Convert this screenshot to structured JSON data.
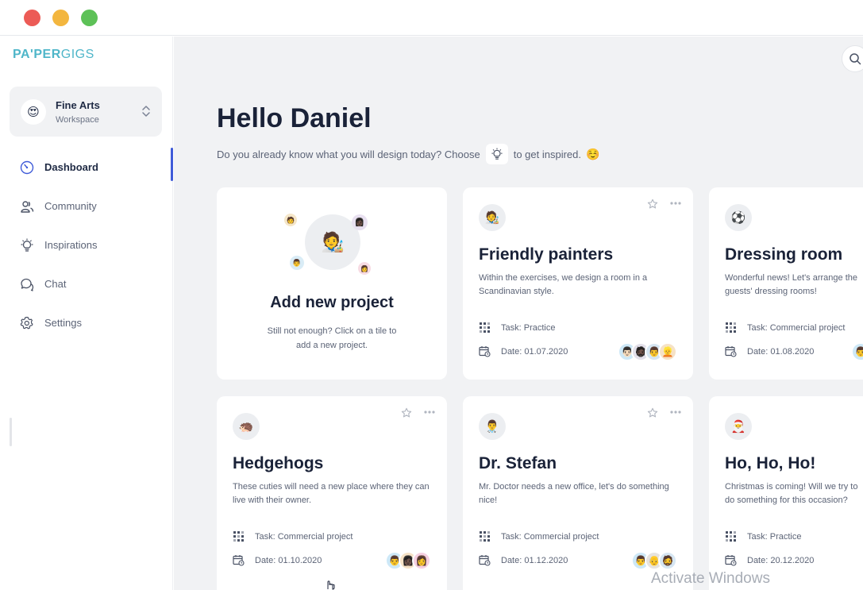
{
  "window": {
    "controls": [
      "close",
      "minimize",
      "maximize"
    ]
  },
  "sidebar": {
    "logo": {
      "bold": "PA'PER",
      "light": "GIGS"
    },
    "workspace": {
      "avatar_emoji": "😍",
      "name": "Fine Arts",
      "subtitle": "Workspace"
    },
    "nav": [
      {
        "label": "Dashboard",
        "icon": "dashboard-gauge-icon",
        "active": true
      },
      {
        "label": "Community",
        "icon": "community-people-icon",
        "active": false
      },
      {
        "label": "Inspirations",
        "icon": "lightbulb-icon",
        "active": false
      },
      {
        "label": "Chat",
        "icon": "chat-bubbles-icon",
        "active": false
      },
      {
        "label": "Settings",
        "icon": "gear-icon",
        "active": false
      }
    ]
  },
  "main": {
    "greeting": "Hello Daniel",
    "subtitle_before": "Do you already know what you will design today? Choose",
    "subtitle_after": "to get inspired.",
    "subtitle_emoji": "☺️",
    "add_card": {
      "title": "Add new project",
      "description": "Still not enough? Click on a tile to add a new project.",
      "main_emoji": "🧑‍🎨",
      "side_emojis": [
        "🧑",
        "👩🏿",
        "👨",
        "👩"
      ]
    },
    "cards": [
      {
        "avatar": "🧑‍🎨",
        "title": "Friendly painters",
        "description": "Within the exercises, we design a room in a Scandinavian style.",
        "task": "Task: Practice",
        "date": "Date: 01.07.2020",
        "members": [
          "👨🏻",
          "🧔🏿",
          "👨",
          "👱"
        ]
      },
      {
        "avatar": "⚽",
        "title": "Dressing room",
        "description": "Wonderful news! Let's arrange the guests' dressing rooms!",
        "task": "Task: Commercial project",
        "date": "Date: 01.08.2020",
        "members": [
          "👨"
        ]
      },
      {
        "avatar": "🦔",
        "title": "Hedgehogs",
        "description": "These cuties will need a new place where they can live with their owner.",
        "task": "Task: Commercial project",
        "date": "Date: 01.10.2020",
        "members": [
          "👨",
          "👩🏿",
          "👩"
        ]
      },
      {
        "avatar": "👨‍⚕️",
        "title": "Dr. Stefan",
        "description": "Mr. Doctor needs a new office, let's do something nice!",
        "task": "Task: Commercial project",
        "date": "Date: 01.12.2020",
        "members": [
          "👨",
          "👴",
          "🧔"
        ]
      },
      {
        "avatar": "🎅",
        "title": "Ho, Ho, Ho!",
        "description": "Christmas is coming! Will we try to do something for this occasion?",
        "task": "Task: Practice",
        "date": "Date: 20.12.2020",
        "members": []
      }
    ]
  },
  "overlay": {
    "watermark": "Activate Windows"
  },
  "colors": {
    "accent": "#3f5bd8",
    "logo": "#4fb6c9",
    "background": "#f1f2f4",
    "heading": "#1a2238"
  }
}
